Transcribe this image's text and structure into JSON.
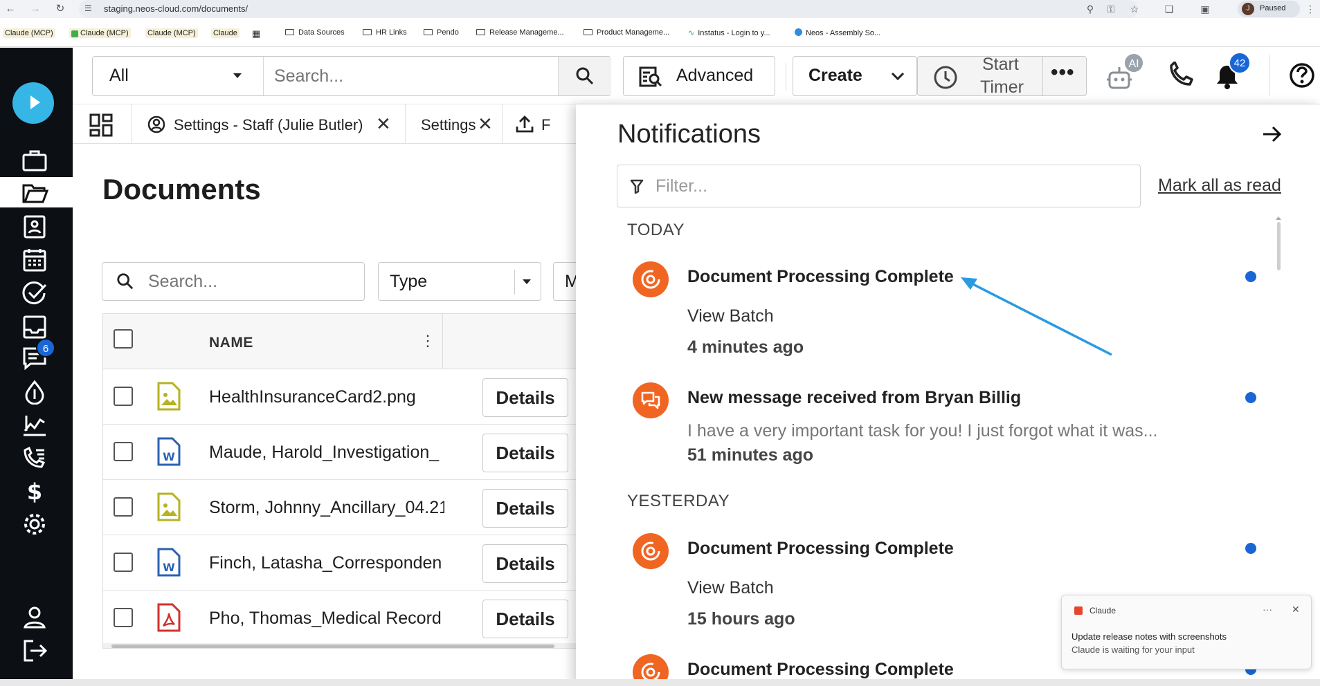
{
  "browser": {
    "url": "staging.neos-cloud.com/documents/",
    "profile_initial": "J",
    "profile_status": "Paused"
  },
  "bookmarks": [
    "Claude (MCP)",
    "Claude (MCP)",
    "Claude (MCP)",
    "Claude",
    "Data Sources",
    "HR Links",
    "Pendo",
    "Release Manageme...",
    "Product Manageme...",
    "Instatus - Login to y...",
    "Neos - Assembly So..."
  ],
  "rail": {
    "messages_badge": "6"
  },
  "topbar": {
    "scope_select": "All",
    "search_placeholder": "Search...",
    "advanced_label": "Advanced",
    "create_label": "Create",
    "timer_label_1": "Start",
    "timer_label_2": "Timer",
    "ai_badge": "AI",
    "notifications_count": "42"
  },
  "tabs": [
    {
      "label": "Settings - Staff (Julie Butler)"
    },
    {
      "label": "Settings"
    },
    {
      "label": "F"
    }
  ],
  "documents": {
    "title": "Documents",
    "search_placeholder": "Search...",
    "type_filter": "Type",
    "third_filter": "M",
    "name_header": "NAME",
    "details_label": "Details",
    "rows": [
      {
        "name": "HealthInsuranceCard2.png",
        "type": "image"
      },
      {
        "name": "Maude, Harold_Investigation_",
        "type": "word"
      },
      {
        "name": "Storm, Johnny_Ancillary_04.21",
        "type": "image"
      },
      {
        "name": "Finch, Latasha_Corresponden",
        "type": "word"
      },
      {
        "name": "Pho, Thomas_Medical Record",
        "type": "pdf"
      }
    ]
  },
  "notifications": {
    "title": "Notifications",
    "filter_placeholder": "Filter...",
    "mark_all_label": "Mark all as read",
    "groups": [
      {
        "label": "TODAY",
        "items": [
          {
            "title": "Document Processing Complete",
            "line1": "View Batch",
            "time": "4 minutes ago",
            "icon": "batch-icon"
          },
          {
            "title": "New message received from Bryan Billig",
            "line1": "I have a very important task for you! I just forgot what it was...",
            "time": "51 minutes ago",
            "icon": "message-icon"
          }
        ]
      },
      {
        "label": "YESTERDAY",
        "items": [
          {
            "title": "Document Processing Complete",
            "line1": "View Batch",
            "time": "15 hours ago",
            "icon": "batch-icon"
          },
          {
            "title": "Document Processing Complete",
            "line1": "",
            "time": "",
            "icon": "batch-icon"
          }
        ]
      }
    ]
  },
  "toast": {
    "app": "Claude",
    "title": "Update release notes with screenshots",
    "subtitle": "Claude is waiting for your input"
  },
  "colors": {
    "accent_blue": "#1a66d6",
    "notif_orange": "#f06522",
    "rail_bg": "#0c0f14",
    "logo_cyan": "#35b6e6",
    "annotation_arrow": "#2a9be0"
  }
}
